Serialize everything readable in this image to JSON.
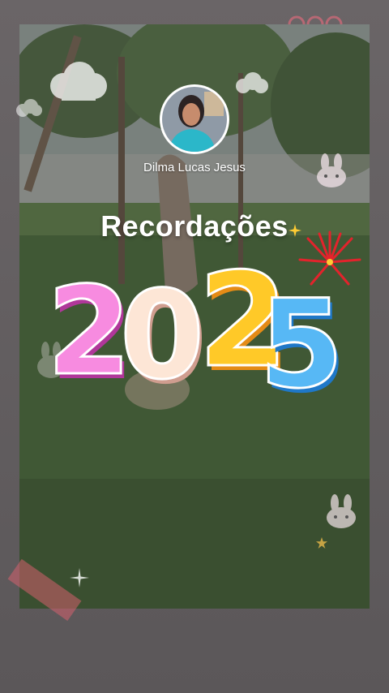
{
  "profile": {
    "name": "Dilma Lucas Jesus"
  },
  "title": "Recordações",
  "year_digits": [
    "2",
    "0",
    "2",
    "5"
  ],
  "colors": {
    "digit_1": "#f78be0",
    "digit_2": "#fde6d6",
    "digit_3": "#ffc928",
    "digit_4": "#57b8f5",
    "firework": "#e3232c"
  },
  "icons": [
    "cloud-icon",
    "bunny-icon",
    "firework-icon",
    "sparkle-icon",
    "tape-icon"
  ]
}
